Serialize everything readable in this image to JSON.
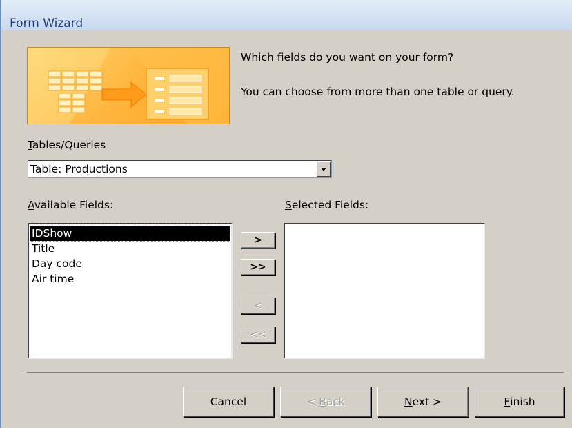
{
  "window": {
    "title": "Form Wizard"
  },
  "prompt": {
    "line1": "Which fields do you want on your form?",
    "line2": "You can choose from more than one table or query."
  },
  "tables_queries": {
    "label_access_key": "T",
    "label_rest": "ables/Queries",
    "selected": "Table: Productions"
  },
  "available_fields": {
    "label_access_key": "A",
    "label_rest": "vailable Fields:",
    "items": [
      "IDShow",
      "Title",
      "Day code",
      "Air time"
    ],
    "selected_index": 0
  },
  "selected_fields": {
    "label_access_key": "S",
    "label_rest": "elected Fields:",
    "items": []
  },
  "move_buttons": {
    "add_one": ">",
    "add_all": ">>",
    "remove_one": "<",
    "remove_all": "<<"
  },
  "footer": {
    "cancel": "Cancel",
    "back_prefix": "< ",
    "back_key": "B",
    "back_rest": "ack",
    "next_key": "N",
    "next_rest": "ext >",
    "finish_key": "F",
    "finish_rest": "inish"
  },
  "colors": {
    "title_text": "#1f3f7a",
    "dialog_bg": "#d4d0c8",
    "banner_orange": "#ffb63f",
    "selection_bg": "#000000"
  }
}
